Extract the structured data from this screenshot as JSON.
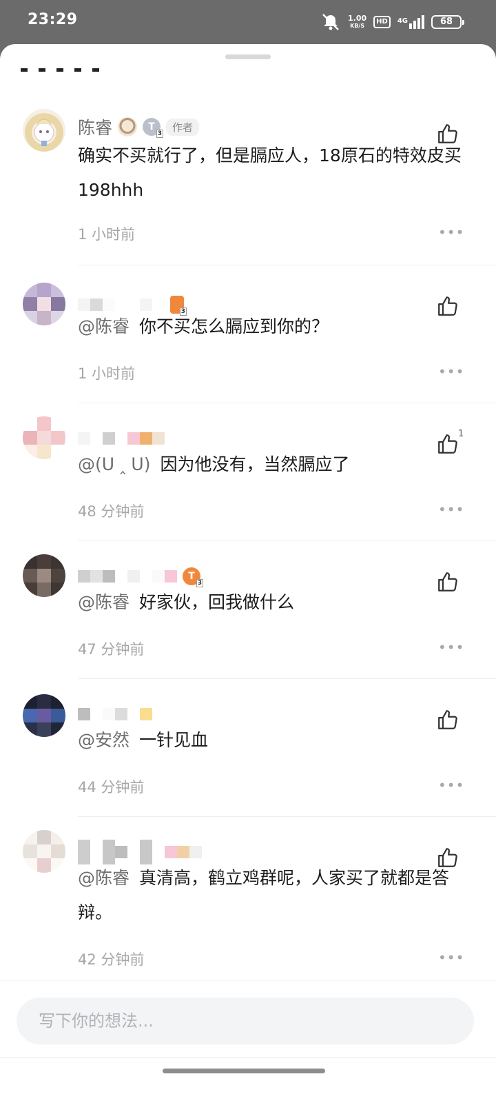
{
  "status_bar": {
    "time": "23:29",
    "net_speed_value": "1.00",
    "net_speed_unit": "KB/S",
    "hd": "HD",
    "network": "4G",
    "battery": "68"
  },
  "comments": [
    {
      "name": "陈睿",
      "author_tag": "作者",
      "level_badge": "T",
      "mention": "",
      "text": "确实不买就行了，但是膈应人，18原石的特效皮买198hhh",
      "time": "1 小时前",
      "likes": ""
    },
    {
      "name": "",
      "level_badge": "",
      "mention": "@陈睿",
      "text": "你不买怎么膈应到你的？",
      "time": "1 小时前",
      "likes": ""
    },
    {
      "name": "",
      "mention": "@(ᑌ ‸ ᑌ)",
      "text": "因为他没有，当然膈应了",
      "time": "48 分钟前",
      "likes": "1"
    },
    {
      "name": "",
      "level_badge": "T",
      "mention": "@陈睿",
      "text": "好家伙，回我做什么",
      "time": "47 分钟前",
      "likes": ""
    },
    {
      "name": "",
      "mention": "@安然",
      "text": "一针见血",
      "time": "44 分钟前",
      "likes": ""
    },
    {
      "name": "",
      "mention": "@陈睿",
      "text": "真清高，鹤立鸡群呢，人家买了就都是答辩。",
      "time": "42 分钟前",
      "likes": ""
    }
  ],
  "icons": {
    "like": "thumbs-up-icon",
    "more": "more-options-icon"
  },
  "more_glyph": "•••",
  "input": {
    "placeholder": "写下你的想法..."
  },
  "colors": {
    "background_overlay": "#6b6b6b",
    "sheet": "#ffffff",
    "badge_orange": "#f0883c",
    "badge_gray": "#b9c0cc"
  }
}
